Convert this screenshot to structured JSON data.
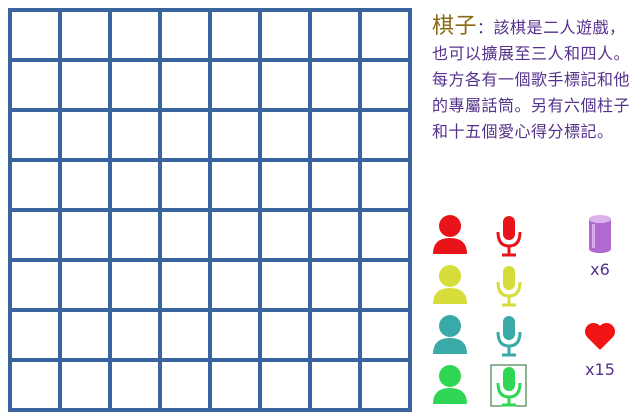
{
  "board": {
    "rows": 8,
    "cols": 8,
    "line_color": "#3a64a0"
  },
  "description": {
    "title": "棋子",
    "sep": "：",
    "text": "該棋是二人遊戲，也可以擴展至三人和四人。每方各有一個歌手標記和他的專屬話筒。另有六個柱子和十五個愛心得分標記。"
  },
  "players": [
    {
      "color": "#e8141a",
      "name": "red"
    },
    {
      "color": "#d6dc3a",
      "name": "yellow"
    },
    {
      "color": "#3aaaa8",
      "name": "teal"
    },
    {
      "color": "#2ed654",
      "name": "green"
    }
  ],
  "pillar": {
    "count": "x6",
    "color": "#b26ad0"
  },
  "heart": {
    "count": "x15",
    "color": "#f21414"
  }
}
